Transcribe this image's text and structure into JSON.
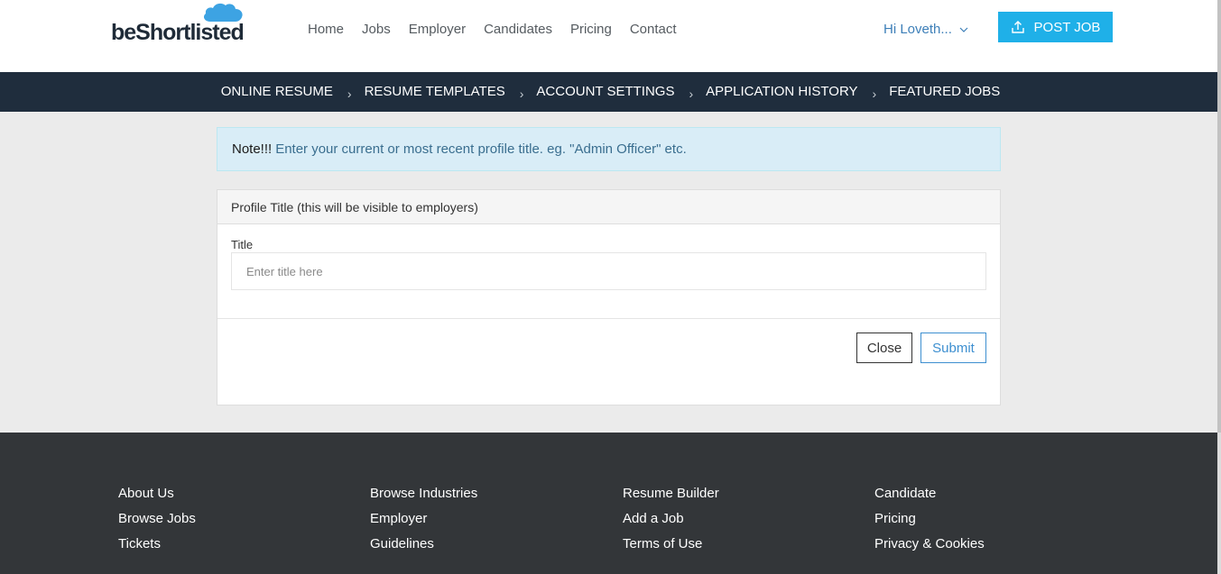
{
  "header": {
    "logo_text": "beShortlisted",
    "nav": [
      "Home",
      "Jobs",
      "Employer",
      "Candidates",
      "Pricing",
      "Contact"
    ],
    "user_greeting": "Hi Loveth...",
    "post_job_label": "POST JOB"
  },
  "subnav": [
    "Online Resume",
    "Resume Templates",
    "Account Settings",
    "Application History",
    "Featured Jobs"
  ],
  "alert": {
    "strong": "Note!!!",
    "message": "Enter your current or most recent profile title. eg. \"Admin Officer\" etc."
  },
  "panel": {
    "heading": "Profile Title (this will be visible to employers)",
    "field_label": "Title",
    "field_placeholder": "Enter title here",
    "field_value": "",
    "close_label": "Close",
    "submit_label": "Submit"
  },
  "footer": {
    "col1": [
      "About Us",
      "Browse Jobs",
      "Tickets"
    ],
    "col2": [
      "Browse Industries",
      "Employer",
      "Guidelines"
    ],
    "col3": [
      "Resume Builder",
      "Add a Job",
      "Terms of Use"
    ],
    "col4": [
      "Candidate",
      "Pricing",
      "Privacy & Cookies"
    ]
  },
  "colors": {
    "accent": "#1fb0e8",
    "subnav_bg": "#1f2d3d",
    "footer_bg": "#333639",
    "alert_bg": "#d9edf7"
  }
}
